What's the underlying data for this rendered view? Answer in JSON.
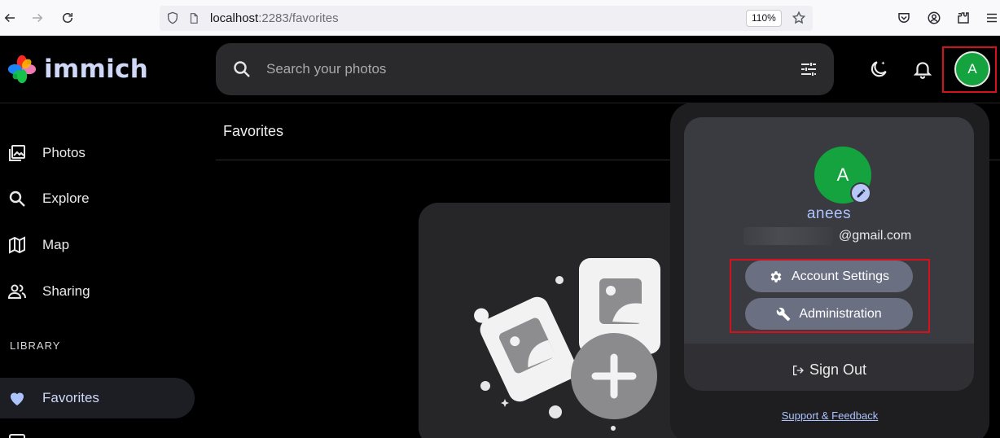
{
  "browser": {
    "url_host": "localhost",
    "url_rest": ":2283/favorites",
    "zoom": "110%"
  },
  "app": {
    "logo_text": "immich",
    "search_placeholder": "Search your photos",
    "avatar_initial": "A"
  },
  "sidebar": {
    "items": [
      {
        "label": "Photos",
        "icon": "photos-icon"
      },
      {
        "label": "Explore",
        "icon": "search-icon"
      },
      {
        "label": "Map",
        "icon": "map-icon"
      },
      {
        "label": "Sharing",
        "icon": "people-icon"
      }
    ],
    "section_label": "LIBRARY",
    "library_items": [
      {
        "label": "Favorites",
        "icon": "heart-icon",
        "active": true
      }
    ]
  },
  "main": {
    "title": "Favorites"
  },
  "account_menu": {
    "avatar_initial": "A",
    "name": "anees",
    "email_domain": "@gmail.com",
    "account_settings_label": "Account Settings",
    "administration_label": "Administration",
    "sign_out_label": "Sign Out",
    "support_label": "Support & Feedback"
  },
  "colors": {
    "accent": "#adc3fd",
    "avatar": "#14a33e",
    "highlight_box": "#d5121b",
    "pill_button": "#6a6f82"
  }
}
